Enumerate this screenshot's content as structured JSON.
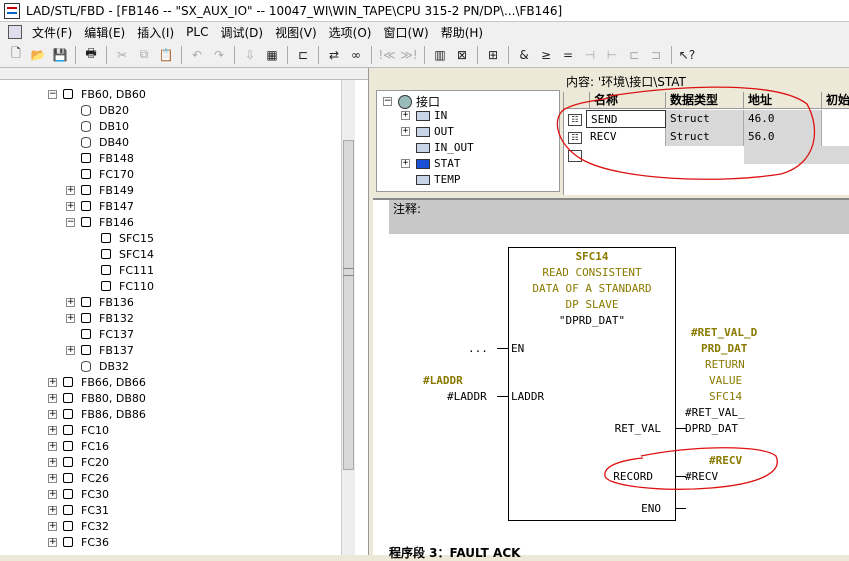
{
  "window": {
    "title": "LAD/STL/FBD  - [FB146 -- \"SX_AUX_IO\" -- 10047_WI\\WIN_TAPE\\CPU 315-2 PN/DP\\...\\FB146]"
  },
  "menu": [
    "文件(F)",
    "编辑(E)",
    "插入(I)",
    "PLC",
    "调试(D)",
    "视图(V)",
    "选项(O)",
    "窗口(W)",
    "帮助(H)"
  ],
  "tree": {
    "items": [
      {
        "label": "FB60, DB60",
        "indent": 0,
        "exp": "-",
        "icon": "blk"
      },
      {
        "label": "DB20",
        "indent": 1,
        "exp": "",
        "icon": "db"
      },
      {
        "label": "DB10",
        "indent": 1,
        "exp": "",
        "icon": "db"
      },
      {
        "label": "DB40",
        "indent": 1,
        "exp": "",
        "icon": "db"
      },
      {
        "label": "FB148",
        "indent": 1,
        "exp": "",
        "icon": "blk"
      },
      {
        "label": "FC170",
        "indent": 1,
        "exp": "",
        "icon": "blk"
      },
      {
        "label": "FB149",
        "indent": 1,
        "exp": "+",
        "icon": "blk"
      },
      {
        "label": "FB147",
        "indent": 1,
        "exp": "+",
        "icon": "blk"
      },
      {
        "label": "FB146",
        "indent": 1,
        "exp": "-",
        "icon": "blk"
      },
      {
        "label": "SFC15",
        "indent": 2,
        "exp": "",
        "icon": "blk"
      },
      {
        "label": "SFC14",
        "indent": 2,
        "exp": "",
        "icon": "blk"
      },
      {
        "label": "FC111",
        "indent": 2,
        "exp": "",
        "icon": "blk"
      },
      {
        "label": "FC110",
        "indent": 2,
        "exp": "",
        "icon": "blk"
      },
      {
        "label": "FB136",
        "indent": 1,
        "exp": "+",
        "icon": "blk"
      },
      {
        "label": "FB132",
        "indent": 1,
        "exp": "+",
        "icon": "blk"
      },
      {
        "label": "FC137",
        "indent": 1,
        "exp": "",
        "icon": "blk"
      },
      {
        "label": "FB137",
        "indent": 1,
        "exp": "+",
        "icon": "blk"
      },
      {
        "label": "DB32",
        "indent": 1,
        "exp": "",
        "icon": "db"
      },
      {
        "label": "FB66, DB66",
        "indent": 0,
        "exp": "+",
        "icon": "blk"
      },
      {
        "label": "FB80, DB80",
        "indent": 0,
        "exp": "+",
        "icon": "blk"
      },
      {
        "label": "FB86, DB86",
        "indent": 0,
        "exp": "+",
        "icon": "blk"
      },
      {
        "label": "FC10",
        "indent": 0,
        "exp": "+",
        "icon": "blk"
      },
      {
        "label": "FC16",
        "indent": 0,
        "exp": "+",
        "icon": "blk"
      },
      {
        "label": "FC20",
        "indent": 0,
        "exp": "+",
        "icon": "blk"
      },
      {
        "label": "FC26",
        "indent": 0,
        "exp": "+",
        "icon": "blk"
      },
      {
        "label": "FC30",
        "indent": 0,
        "exp": "+",
        "icon": "blk"
      },
      {
        "label": "FC31",
        "indent": 0,
        "exp": "+",
        "icon": "blk"
      },
      {
        "label": "FC32",
        "indent": 0,
        "exp": "+",
        "icon": "blk"
      },
      {
        "label": "FC36",
        "indent": 0,
        "exp": "+",
        "icon": "blk"
      }
    ]
  },
  "interface": {
    "content_label": "内容: '环境\\接口\\STAT",
    "root": "接口",
    "items": [
      "IN",
      "OUT",
      "IN_OUT",
      "STAT",
      "TEMP"
    ],
    "columns": [
      "名称",
      "数据类型",
      "地址",
      "初始"
    ],
    "rows": [
      {
        "name": "SEND",
        "type": "Struct",
        "address": "46.0"
      },
      {
        "name": "RECV",
        "type": "Struct",
        "address": "56.0"
      }
    ]
  },
  "code": {
    "comment_label": "注释:",
    "block": {
      "title": "SFC14",
      "desc": [
        "READ CONSISTENT",
        "DATA OF A STANDARD",
        "DP SLAVE"
      ],
      "instance": "\"DPRD_DAT\""
    },
    "pins": {
      "en": "EN",
      "laddr": "LADDR",
      "ret_val": "RET_VAL",
      "record": "RECORD",
      "eno": "ENO"
    },
    "en_input": "...",
    "laddr_symbol": "#LADDR",
    "laddr_input": "#LADDR",
    "retval_symbol": [
      "#RET_VAL_D",
      "PRD_DAT"
    ],
    "retval_comment": [
      "RETURN",
      "VALUE",
      "SFC14"
    ],
    "retval_output": [
      "#RET_VAL_",
      "DPRD_DAT"
    ],
    "recv_symbol": "#RECV",
    "recv_output": "#RECV",
    "network_title": "程序段 3：FAULT ACK"
  },
  "colors": {
    "accent_red": "#d11",
    "symbol_olive": "#8a7a00"
  }
}
